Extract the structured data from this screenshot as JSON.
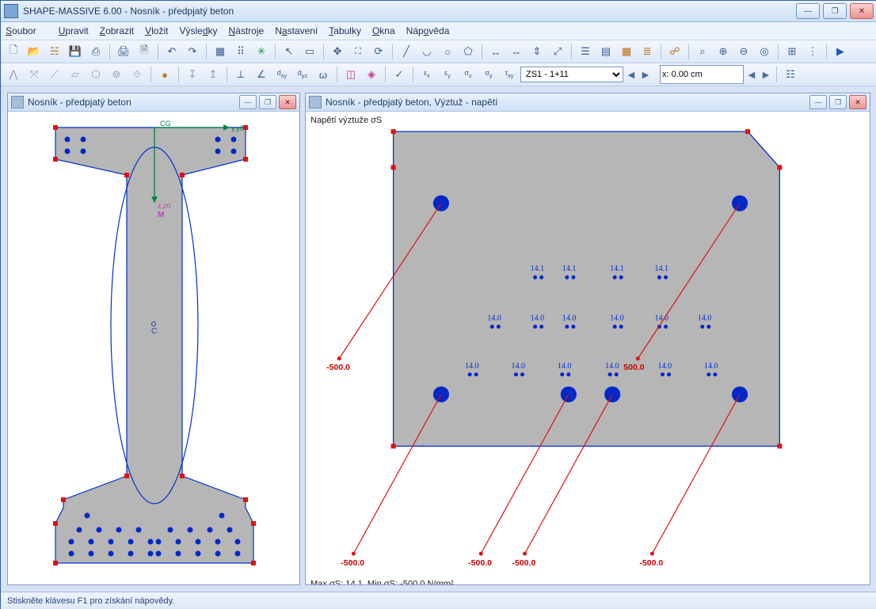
{
  "titlebar": {
    "text": "SHAPE-MASSIVE 6.00 - Nosník - předpjatý beton"
  },
  "menu": [
    "Soubor",
    "Upravit",
    "Zobrazit",
    "Vložit",
    "Výsledky",
    "Nástroje",
    "Nastavení",
    "Tabulky",
    "Okna",
    "Nápověda"
  ],
  "toolbar2": {
    "combo_loadcase": "ZS1 - 1+11",
    "x_value": "x: 0.00 cm"
  },
  "left_pane": {
    "title": "Nosník - předpjatý beton"
  },
  "right_pane": {
    "title": "Nosník - předpjatý beton, Výztuž - napětí",
    "axis_label": "Napětí výztuže σS",
    "footer": "Max σS: 14.1, Min σS: -500.0 N/mm²",
    "row_top_val": "14.1",
    "row_mid_val": "14.0",
    "row_bot_val": "14.0",
    "neg_val": "-500.0",
    "pos_val": "500.0"
  },
  "statusbar": {
    "text": "Stiskněte klávesu F1 pro získání nápovědy."
  }
}
